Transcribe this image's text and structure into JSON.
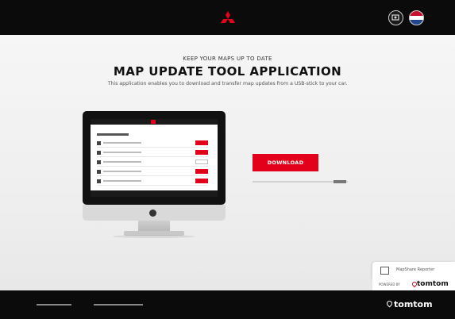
{
  "header": {
    "brand_icon": "mitsubishi-diamond-logo",
    "account_icon": "account-icon",
    "language_flag_colors": [
      "#c8102e",
      "#ffffff",
      "#21468b"
    ]
  },
  "hero": {
    "kicker": "KEEP YOUR MAPS UP TO DATE",
    "title": "MAP UPDATE TOOL APPLICATION",
    "description": "This application enables you to download and transfer map updates from a USB-stick to your car.",
    "download_label": "DOWNLOAD"
  },
  "side_panel": {
    "mapshare_icon": "edit-note-icon",
    "mapshare_label": "MapShare Reporter",
    "powered_by_label": "POWERED BY",
    "powered_brand": "tomtom"
  },
  "footer": {
    "brand": "tomtom",
    "link_icons": [
      "footer-link-1",
      "footer-link-2"
    ]
  },
  "colors": {
    "accent": "#e3001b",
    "bar": "#0b0b0b"
  }
}
